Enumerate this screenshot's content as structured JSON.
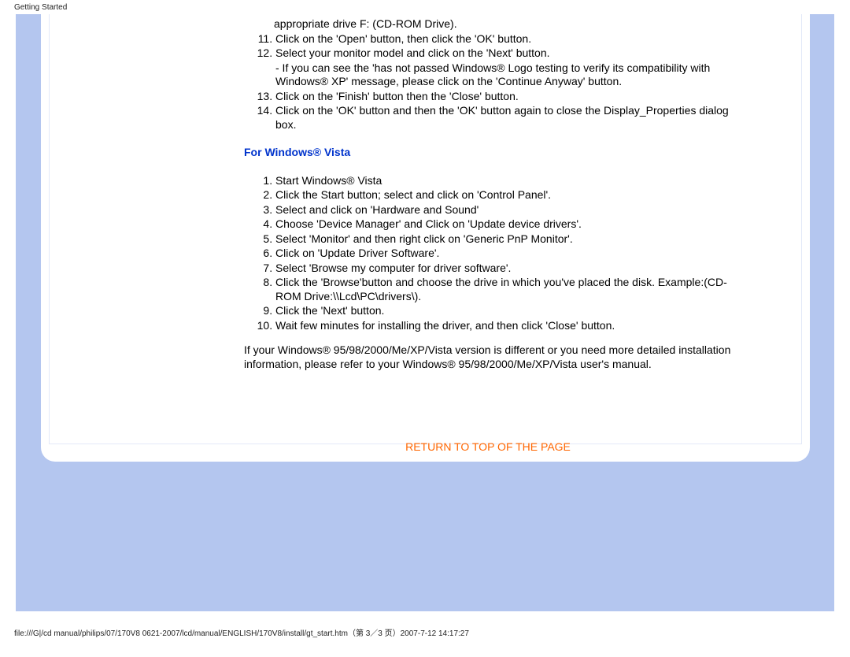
{
  "header": {
    "label": "Getting Started"
  },
  "winxp_continued": {
    "item10_tail": "appropriate drive F: (CD-ROM Drive).",
    "item11": "Click on the 'Open' button, then click the 'OK' button.",
    "item12_a": "Select your monitor model and click on the 'Next' button.",
    "item12_b": "- If you can see the 'has not passed Windows® Logo testing to verify its compatibility with Windows® XP' message, please click on the 'Continue Anyway' button.",
    "item13": "Click on the 'Finish' button then the 'Close' button.",
    "item14": "Click on the 'OK' button and then the 'OK' button again to close the Display_Properties dialog box."
  },
  "vista": {
    "heading": "For Windows® Vista",
    "items": {
      "i1": "Start Windows® Vista",
      "i2": "Click the Start button; select and click on 'Control Panel'.",
      "i3": "Select and click on 'Hardware and Sound'",
      "i4": "Choose 'Device Manager' and Click on 'Update device drivers'.",
      "i5": "Select 'Monitor' and then right click on 'Generic PnP Monitor'.",
      "i6": "Click on 'Update Driver Software'.",
      "i7": "Select 'Browse my computer for driver software'.",
      "i8": "Click the 'Browse'button and choose the drive in which you've placed the disk. Example:(CD-ROM Drive:\\\\Lcd\\PC\\drivers\\).",
      "i9": "Click the 'Next' button.",
      "i10": "Wait few minutes for installing the driver, and then click 'Close' button."
    }
  },
  "closing_para": "If your Windows® 95/98/2000/Me/XP/Vista version is different or you need more detailed installation information, please refer to your Windows® 95/98/2000/Me/XP/Vista user's manual.",
  "return_link": "RETURN TO TOP OF THE PAGE",
  "footer": "file:///G|/cd manual/philips/07/170V8 0621-2007/lcd/manual/ENGLISH/170V8/install/gt_start.htm（第 3／3 页）2007-7-12 14:17:27"
}
